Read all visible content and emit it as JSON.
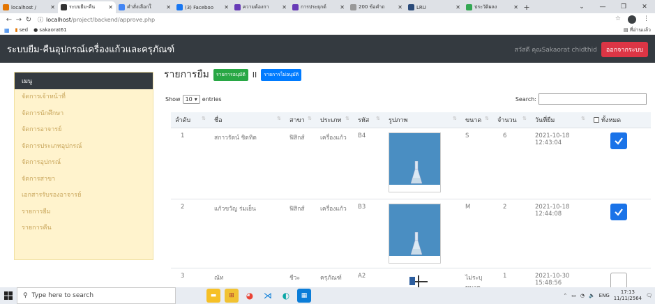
{
  "browser": {
    "tabs": [
      {
        "title": "localhost /",
        "active": false,
        "color": "#e37400"
      },
      {
        "title": "ระบบยืม-คืน",
        "active": true,
        "color": "#333333"
      },
      {
        "title": "คำสั่งเลือกใ",
        "active": false,
        "color": "#4285f4"
      },
      {
        "title": "(3) Faceboo",
        "active": false,
        "color": "#1877f2"
      },
      {
        "title": "ความต้องกา",
        "active": false,
        "color": "#673ab7"
      },
      {
        "title": "การประยุกต์",
        "active": false,
        "color": "#673ab7"
      },
      {
        "title": "200 ข้อคำถ",
        "active": false,
        "color": "#999999"
      },
      {
        "title": "LRU",
        "active": false,
        "color": "#2b4b7a"
      },
      {
        "title": "ประวัติผลง",
        "active": false,
        "color": "#34a853"
      }
    ],
    "url_host": "localhost",
    "url_path": "/project/backend/approve.php",
    "bookmarks": [
      "sed",
      "sakaorat61"
    ],
    "bookmarks_right": "ที่อ่านแล้ว"
  },
  "navbar": {
    "brand": "ระบบยืม-คืนอุปกรณ์เครื่องแก้วและครุภัณฑ์",
    "welcome": "สวัสดี คุณSakaorat chidthid",
    "logout": "ออกจากระบบ"
  },
  "sidebar": {
    "header": "เมนู",
    "items": [
      {
        "label": "จัดการเจ้าหน้าที่"
      },
      {
        "label": "จัดการนักศึกษา"
      },
      {
        "label": "จัดการอาจารย์"
      },
      {
        "label": "จัดการประเภทอุปกรณ์"
      },
      {
        "label": "จัดการอุปกรณ์"
      },
      {
        "label": "จัดการสาขา"
      },
      {
        "label": "เอกสารรับรองอาจารย์"
      },
      {
        "label": "รายการยืม"
      },
      {
        "label": "รายการคืน"
      }
    ]
  },
  "main": {
    "title": "รายการยืม",
    "btn_approved": "รายการอนุมัติ",
    "separator": "II",
    "btn_rejected": "รายการไม่อนุมัติ",
    "show_label": "Show",
    "entries_value": "10",
    "entries_label": "entries",
    "search_label": "Search:",
    "columns": {
      "no": "ลำดับ",
      "name": "ชื่อ",
      "branch": "สาขา",
      "type": "ประเภท",
      "code": "รหัส",
      "image": "รูปภาพ",
      "size": "ขนาด",
      "qty": "จำนวน",
      "date": "วันที่ยืม",
      "all": "ทั้งหมด"
    },
    "rows": [
      {
        "no": "1",
        "name": "สกาวรัตน์ ชิดทิด",
        "branch": "ฟิสิกส์",
        "type": "เครื่องแก้ว",
        "code": "B4",
        "size": "S",
        "qty": "6",
        "date": "2021-10-18 12:43:04",
        "checked": true,
        "image": "erlenmeyer-flask"
      },
      {
        "no": "2",
        "name": "แก้วขวัญ ร่มเย็น",
        "branch": "ฟิสิกส์",
        "type": "เครื่องแก้ว",
        "code": "B3",
        "size": "M",
        "qty": "2",
        "date": "2021-10-18 12:44:08",
        "checked": true,
        "image": "erlenmeyer-flask"
      },
      {
        "no": "3",
        "name": "ณัท",
        "branch": "ชีวะ",
        "type": "ครุภัณฑ์",
        "code": "A2",
        "size": "ไม่ระบุขนาด",
        "qty": "1",
        "date": "2021-10-30 15:48:56",
        "checked": false,
        "image": "lab-stand"
      }
    ]
  },
  "taskbar": {
    "search_placeholder": "Type here to search",
    "lang": "ENG",
    "time": "17:13",
    "date": "11/11/2564"
  }
}
